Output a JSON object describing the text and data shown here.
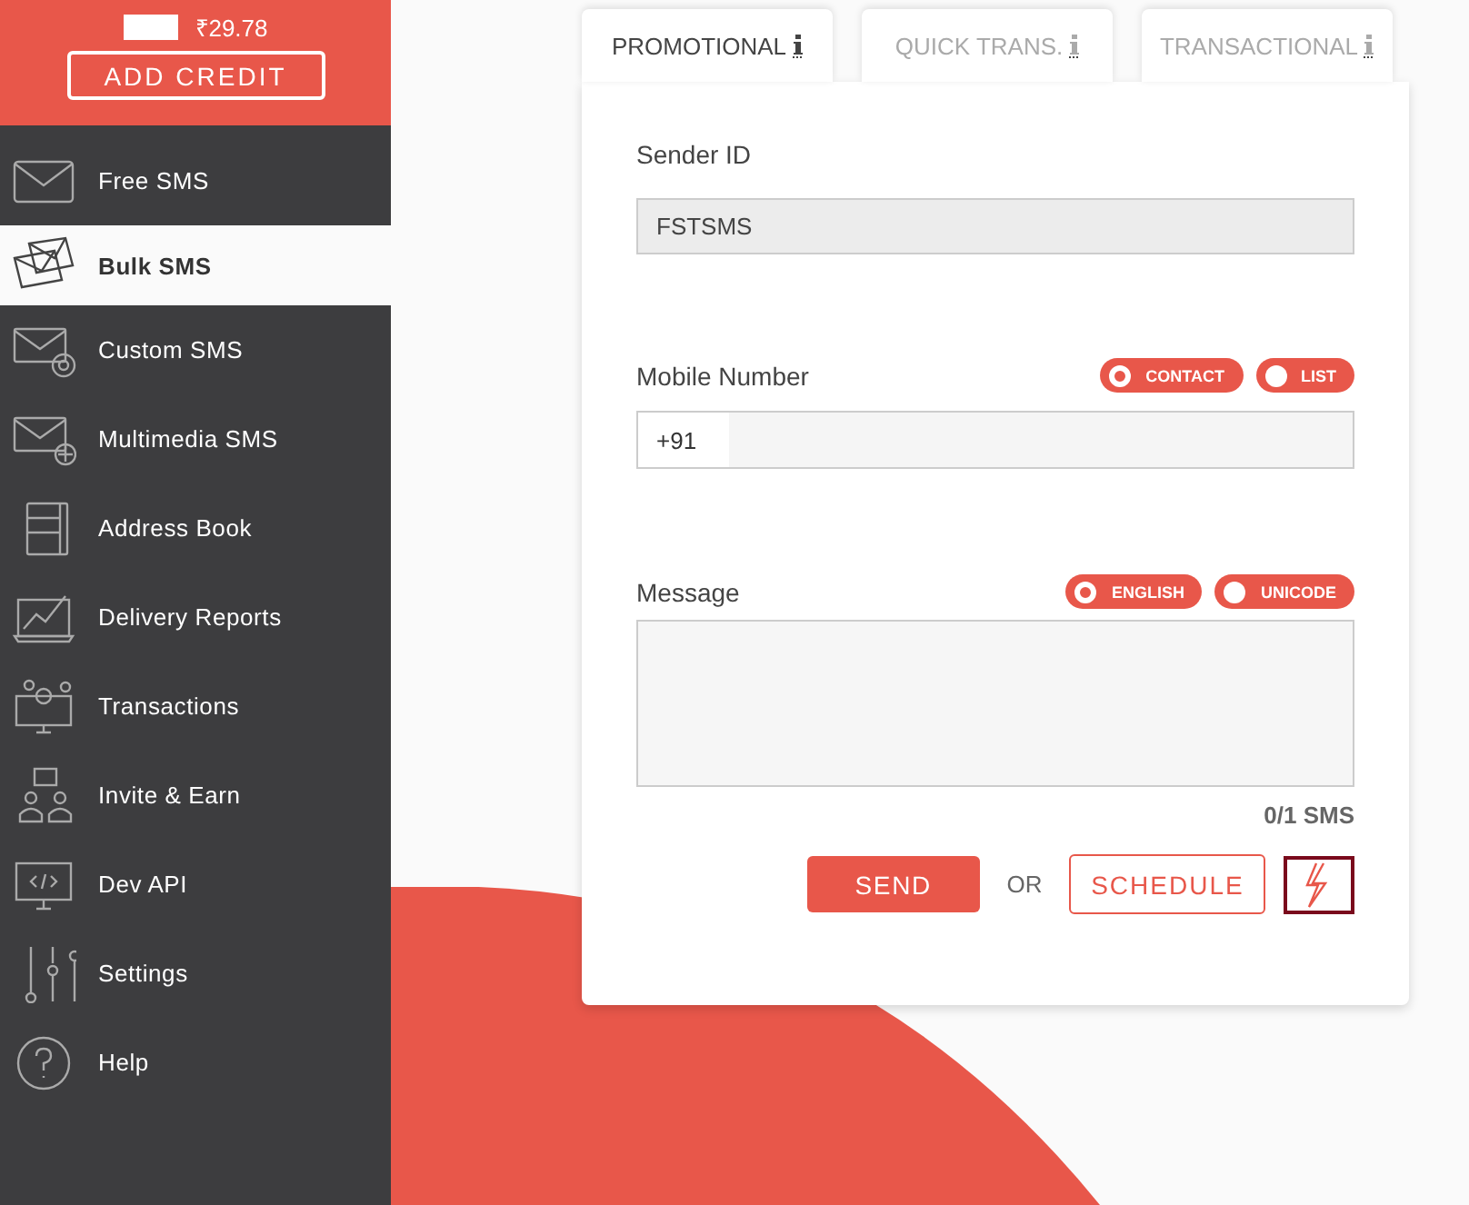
{
  "balance": "₹29.78",
  "add_credit": "ADD CREDIT",
  "sidebar": {
    "items": [
      {
        "label": "Free SMS",
        "selected": false
      },
      {
        "label": "Bulk SMS",
        "selected": true
      },
      {
        "label": "Custom SMS",
        "selected": false
      },
      {
        "label": "Multimedia SMS",
        "selected": false
      },
      {
        "label": "Address Book",
        "selected": false
      },
      {
        "label": "Delivery Reports",
        "selected": false
      },
      {
        "label": "Transactions",
        "selected": false
      },
      {
        "label": "Invite & Earn",
        "selected": false
      },
      {
        "label": "Dev API",
        "selected": false
      },
      {
        "label": "Settings",
        "selected": false
      },
      {
        "label": "Help",
        "selected": false
      }
    ]
  },
  "tabs": [
    {
      "label": "PROMOTIONAL",
      "selected": true
    },
    {
      "label": "QUICK TRANS.",
      "selected": false
    },
    {
      "label": "TRANSACTIONAL",
      "selected": false
    }
  ],
  "sender_id": {
    "label": "Sender ID",
    "value": "FSTSMS"
  },
  "mobile": {
    "label": "Mobile Number",
    "prefix": "+91",
    "options": [
      {
        "label": "CONTACT",
        "selected": true
      },
      {
        "label": "LIST",
        "selected": false
      }
    ]
  },
  "message": {
    "label": "Message",
    "options": [
      {
        "label": "ENGLISH",
        "selected": true
      },
      {
        "label": "UNICODE",
        "selected": false
      }
    ],
    "counter": "0/1 SMS"
  },
  "send": "SEND",
  "or": "OR",
  "schedule": "SCHEDULE"
}
